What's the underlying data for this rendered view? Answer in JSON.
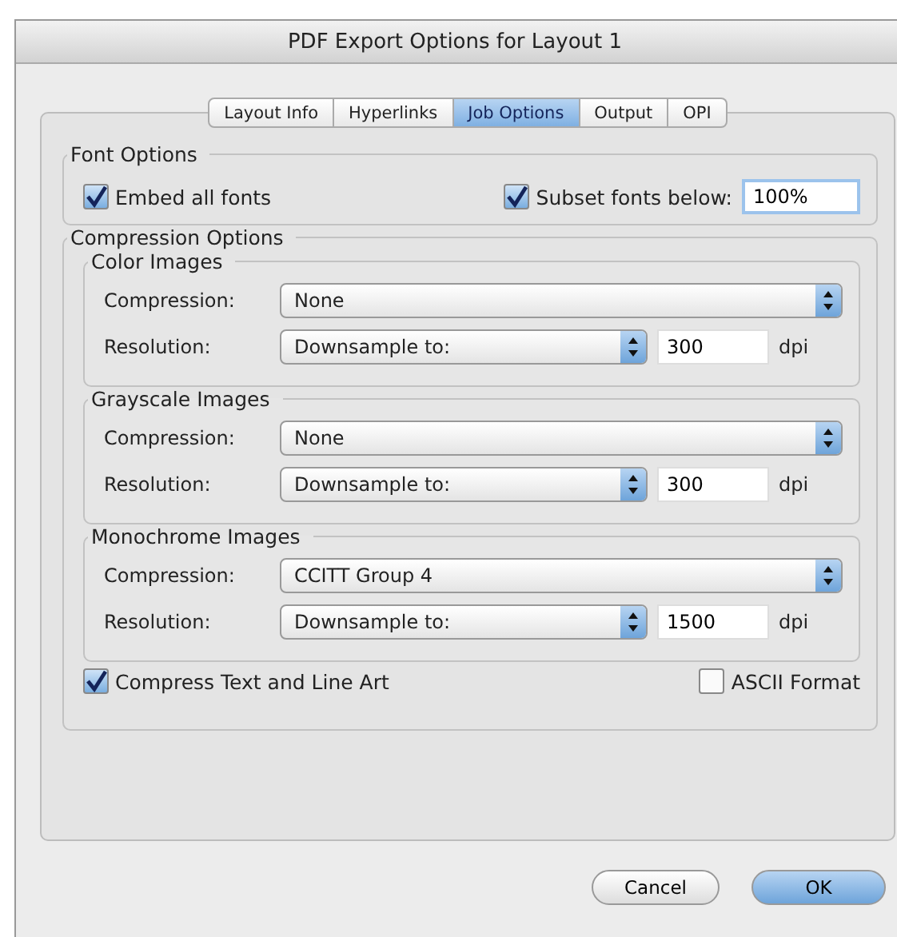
{
  "window": {
    "title": "PDF Export Options for Layout 1"
  },
  "tabs": [
    {
      "label": "Layout Info",
      "selected": false
    },
    {
      "label": "Hyperlinks",
      "selected": false
    },
    {
      "label": "Job Options",
      "selected": true
    },
    {
      "label": "Output",
      "selected": false
    },
    {
      "label": "OPI",
      "selected": false
    }
  ],
  "font_options": {
    "title": "Font Options",
    "embed_all_fonts": {
      "label": "Embed all fonts",
      "checked": true
    },
    "subset_fonts": {
      "label": "Subset fonts below:",
      "checked": true,
      "value": "100%"
    }
  },
  "compression_options": {
    "title": "Compression Options",
    "groups": [
      {
        "title": "Color Images",
        "compression_label": "Compression:",
        "compression": "None",
        "resolution_label": "Resolution:",
        "resolution": "Downsample to:",
        "dpi": "300",
        "unit": "dpi"
      },
      {
        "title": "Grayscale Images",
        "compression_label": "Compression:",
        "compression": "None",
        "resolution_label": "Resolution:",
        "resolution": "Downsample to:",
        "dpi": "300",
        "unit": "dpi"
      },
      {
        "title": "Monochrome Images",
        "compression_label": "Compression:",
        "compression": "CCITT Group 4",
        "resolution_label": "Resolution:",
        "resolution": "Downsample to:",
        "dpi": "1500",
        "unit": "dpi"
      }
    ],
    "compress_text": {
      "label": "Compress Text and Line Art",
      "checked": true
    },
    "ascii_format": {
      "label": "ASCII Format",
      "checked": false
    }
  },
  "buttons": [
    {
      "label": "Cancel",
      "default": false
    },
    {
      "label": "OK",
      "default": true
    }
  ]
}
